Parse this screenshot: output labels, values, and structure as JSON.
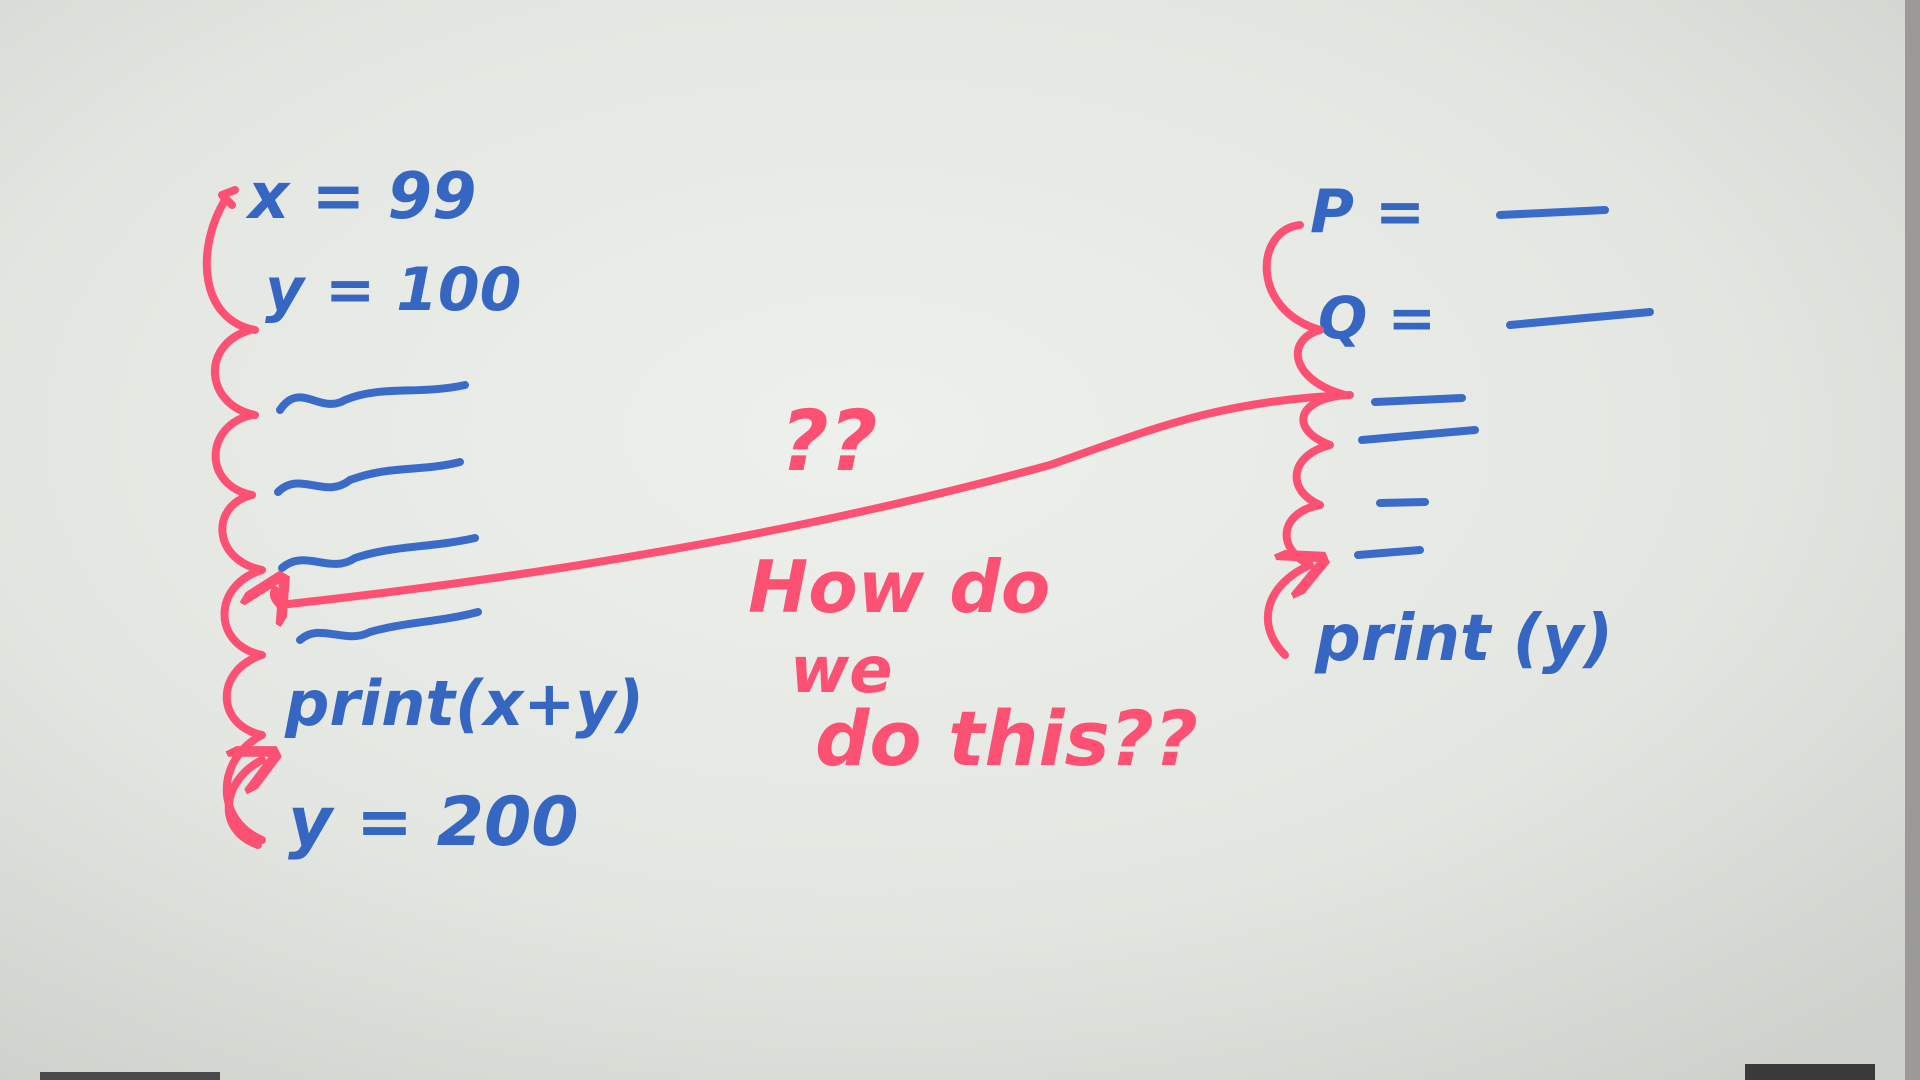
{
  "left_program": {
    "lines": [
      "x = 99",
      "y = 100",
      "print(x+y)",
      "y = 200"
    ]
  },
  "right_program": {
    "lines": [
      "P =",
      "Q =",
      "print (y)"
    ]
  },
  "annotation": {
    "marks": "??",
    "question_line1": "How do",
    "question_line2": "we",
    "question_line3": "do this??"
  },
  "colors": {
    "board": "#e6e8e3",
    "blue_marker": "#3566c2",
    "red_marker": "#fc5173"
  }
}
